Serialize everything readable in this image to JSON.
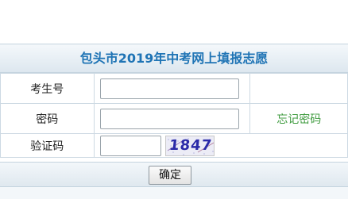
{
  "form": {
    "title": "包头市2019年中考网上填报志愿",
    "fields": [
      {
        "label": "考生号",
        "value": "",
        "placeholder": ""
      },
      {
        "label": "密码",
        "value": "",
        "placeholder": ""
      },
      {
        "label": "验证码",
        "value": "",
        "placeholder": ""
      }
    ],
    "forgot_password_link": "忘记密码",
    "captcha_text": "1847",
    "submit_label": "确定"
  },
  "colors": {
    "title": "#1f74b5",
    "link": "#3f9b3f",
    "captcha": "#2a2aa8"
  }
}
